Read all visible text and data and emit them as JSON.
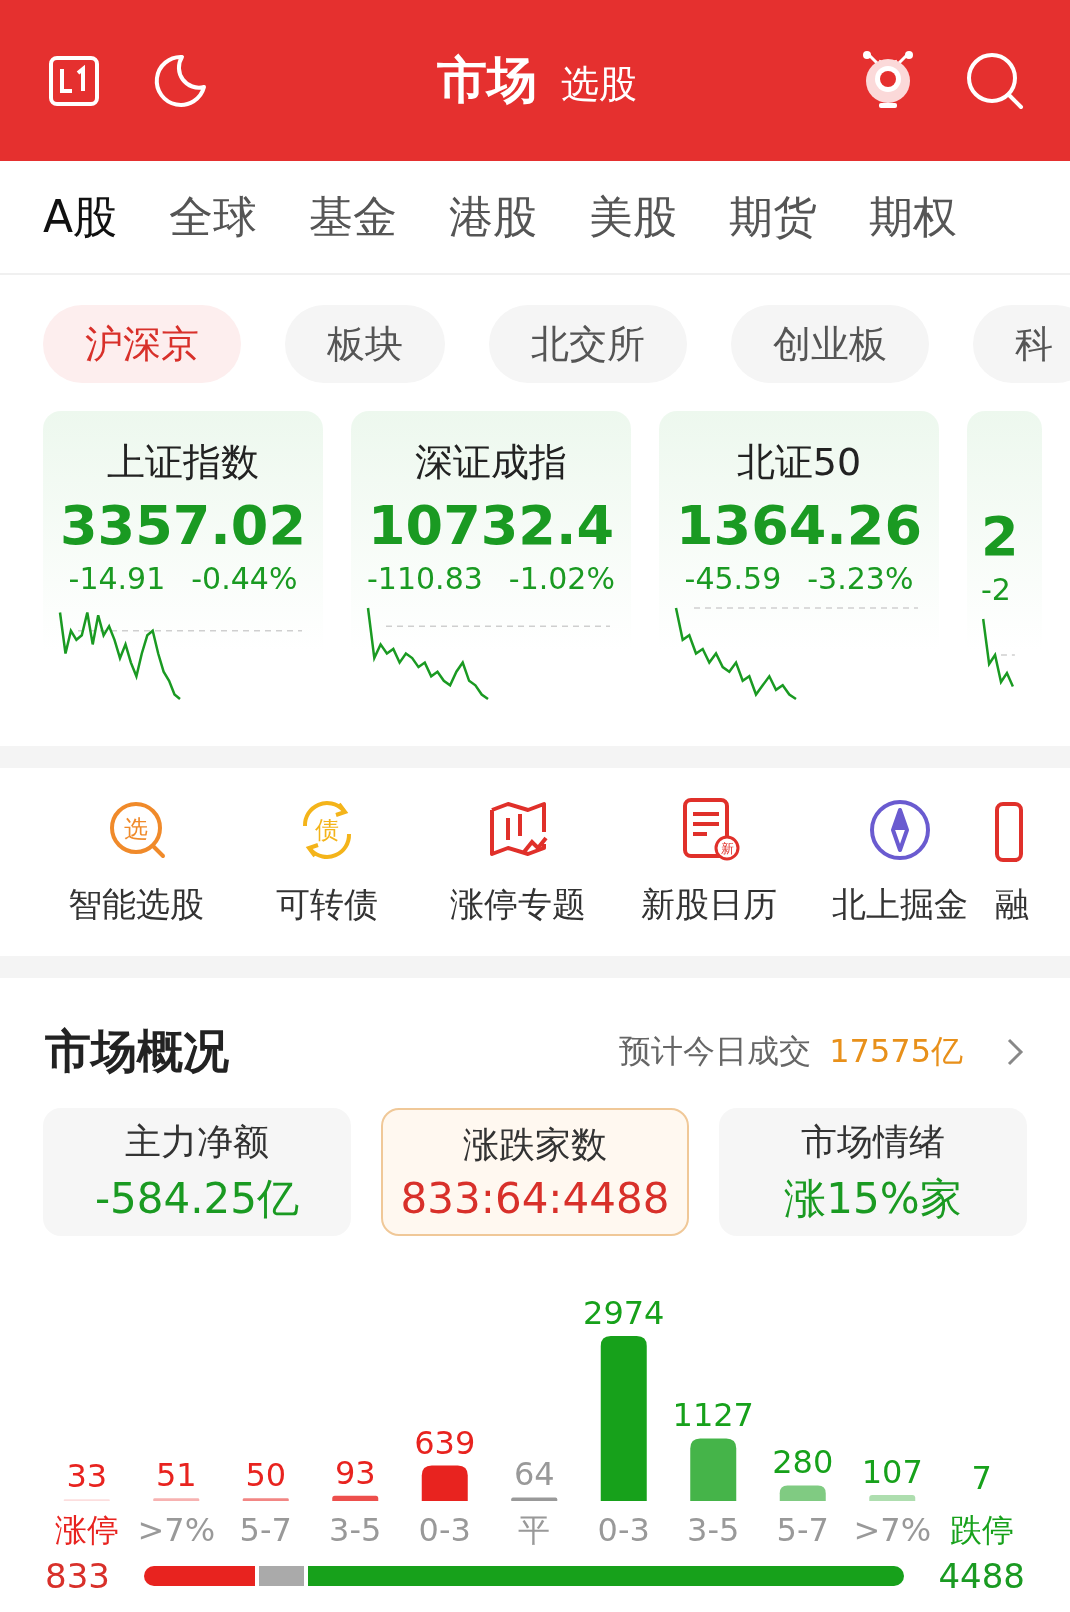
{
  "header": {
    "title": "市场",
    "subtitle": "选股"
  },
  "tabs": [
    {
      "label": "A股",
      "selected": true
    },
    {
      "label": "全球",
      "selected": false
    },
    {
      "label": "基金",
      "selected": false
    },
    {
      "label": "港股",
      "selected": false
    },
    {
      "label": "美股",
      "selected": false
    },
    {
      "label": "期货",
      "selected": false
    },
    {
      "label": "期权",
      "selected": false
    }
  ],
  "chips": [
    {
      "label": "沪深京",
      "selected": true
    },
    {
      "label": "板块",
      "selected": false
    },
    {
      "label": "北交所",
      "selected": false
    },
    {
      "label": "创业板",
      "selected": false
    },
    {
      "label": "科",
      "selected": false
    }
  ],
  "indices": [
    {
      "name": "上证指数",
      "value": "3357.02",
      "change": "-14.91",
      "percent": "-0.44%"
    },
    {
      "name": "深证成指",
      "value": "10732.4",
      "change": "-110.83",
      "percent": "-1.02%"
    },
    {
      "name": "北证50",
      "value": "1364.26",
      "change": "-45.59",
      "percent": "-3.23%"
    },
    {
      "value": "2",
      "change": "-2"
    }
  ],
  "shortcuts": [
    {
      "kind": "search",
      "badge": "选",
      "label": "智能选股"
    },
    {
      "kind": "cycle",
      "badge": "债",
      "label": "可转债"
    },
    {
      "kind": "map",
      "label": "涨停专题"
    },
    {
      "kind": "calendar",
      "badge": "新",
      "label": "新股日历"
    },
    {
      "kind": "compass",
      "label": "北上掘金"
    },
    {
      "kind": "partial",
      "label": "融"
    }
  ],
  "overview": {
    "title": "市场概况",
    "turnover_label": "预计今日成交",
    "turnover": "17575亿",
    "stats": [
      {
        "label": "主力净额",
        "value": "-584.25亿",
        "color": "#1a9a22",
        "selected": false
      },
      {
        "label": "涨跌家数",
        "value": "833:64:4488",
        "color": "#d8302a",
        "selected": true
      },
      {
        "label": "市场情绪",
        "value": "涨15%家",
        "color": "#1a9a22",
        "selected": false
      }
    ],
    "chart_data": {
      "type": "bar",
      "categories": [
        "涨停",
        ">7%",
        "5-7",
        "3-5",
        "0-3",
        "平",
        "0-3",
        "3-5",
        "5-7",
        ">7%",
        "跌停"
      ],
      "data_labels": true,
      "series": [
        {
          "color": "#e8231f",
          "values": [
            33,
            51,
            50,
            93,
            639,
            null,
            null,
            null,
            null,
            null,
            null
          ]
        },
        {
          "color": "#999999",
          "values": [
            null,
            null,
            null,
            null,
            null,
            64,
            null,
            null,
            null,
            null,
            null
          ]
        },
        {
          "color": "#17a11b",
          "values": [
            null,
            null,
            null,
            null,
            null,
            null,
            2974,
            1127,
            280,
            107,
            7
          ]
        }
      ]
    },
    "ratio": {
      "up": "833",
      "down": "4488"
    }
  }
}
